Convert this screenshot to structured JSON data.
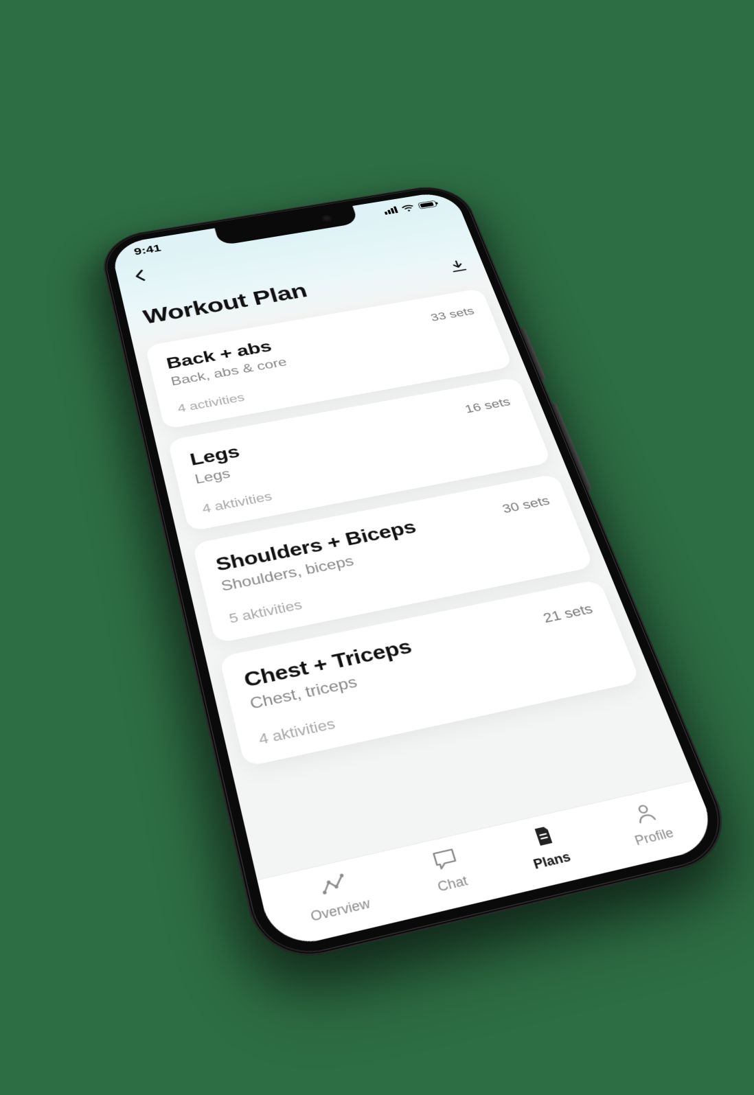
{
  "status": {
    "time": "9:41"
  },
  "header": {
    "title": "Workout Plan"
  },
  "workouts": [
    {
      "title": "Back + abs",
      "sub": "Back, abs & core",
      "activities": "4 activities",
      "sets": "33 sets"
    },
    {
      "title": "Legs",
      "sub": "Legs",
      "activities": "4 aktivities",
      "sets": "16 sets"
    },
    {
      "title": "Shoulders + Biceps",
      "sub": "Shoulders, biceps",
      "activities": "5 aktivities",
      "sets": "30 sets"
    },
    {
      "title": "Chest + Triceps",
      "sub": "Chest, triceps",
      "activities": "4 aktivities",
      "sets": "21 sets"
    }
  ],
  "tabs": [
    {
      "label": "Overview"
    },
    {
      "label": "Chat"
    },
    {
      "label": "Plans"
    },
    {
      "label": "Profile"
    }
  ]
}
